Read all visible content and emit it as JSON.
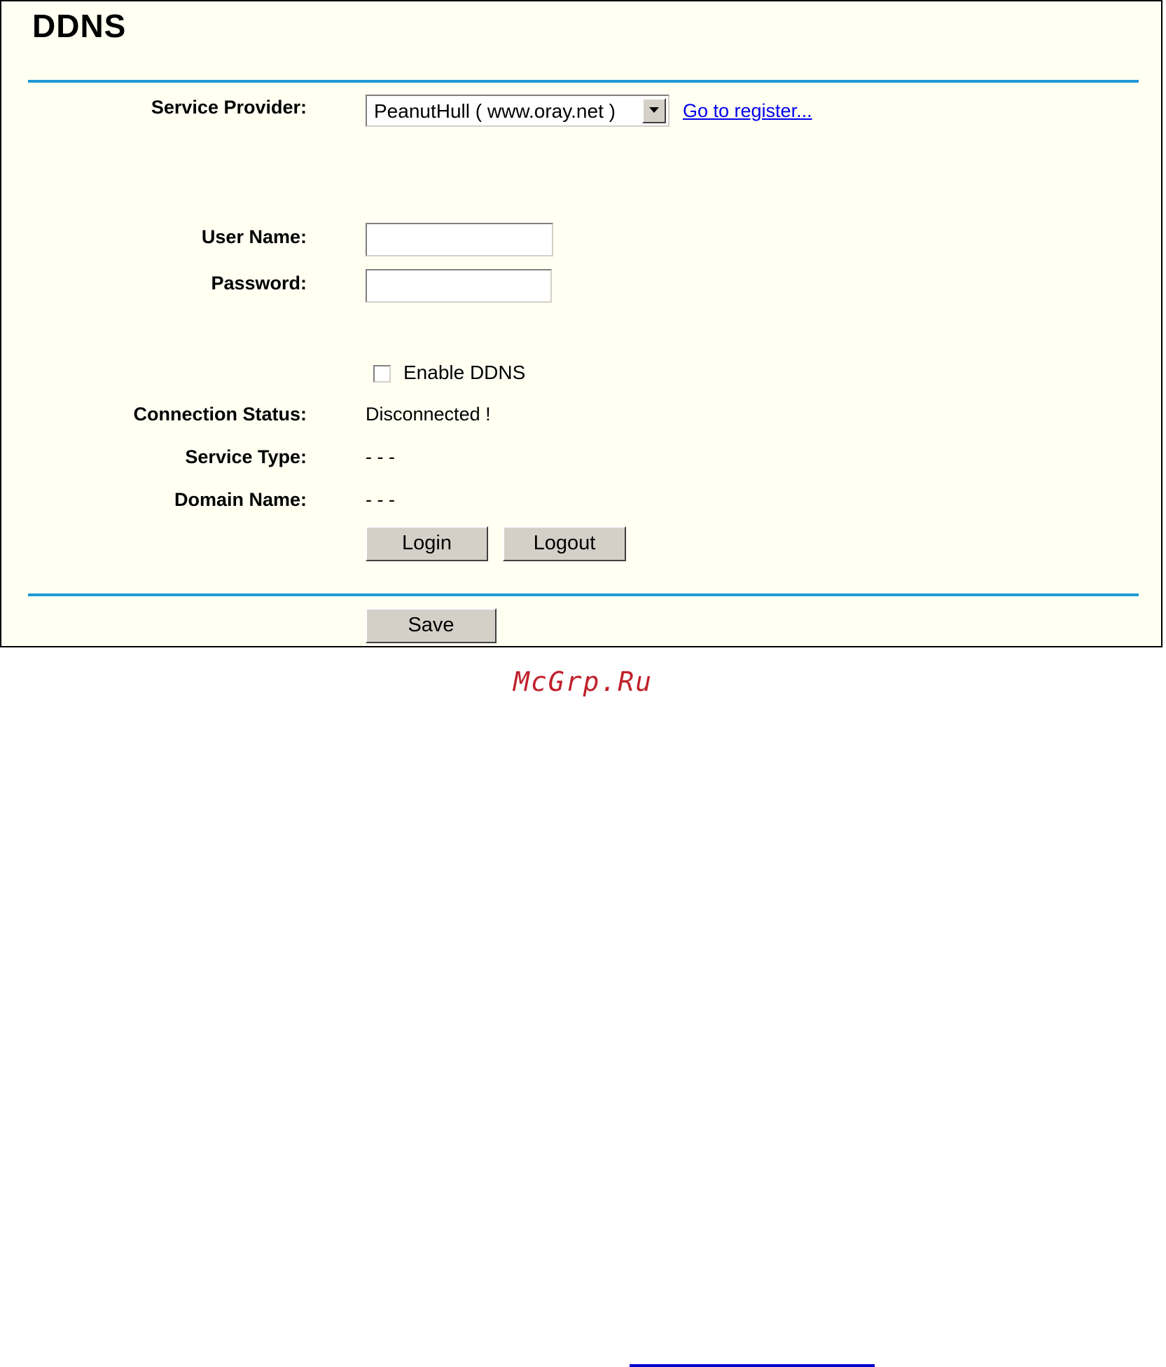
{
  "page": {
    "title": "DDNS"
  },
  "form": {
    "service_provider": {
      "label": "Service Provider:",
      "selected": "PeanutHull ( www.oray.net )",
      "register_link": "Go to register..."
    },
    "user_name": {
      "label": "User Name:",
      "value": ""
    },
    "password": {
      "label": "Password:",
      "value": ""
    },
    "enable_ddns": {
      "label": "Enable DDNS",
      "checked": false
    },
    "connection_status": {
      "label": "Connection Status:",
      "value": "Disconnected !"
    },
    "service_type": {
      "label": "Service Type:",
      "value": "- - -"
    },
    "domain_name": {
      "label": "Domain Name:",
      "value": "- - -"
    },
    "buttons": {
      "login": "Login",
      "logout": "Logout",
      "save": "Save"
    }
  },
  "watermark": {
    "text": "McGrp.Ru"
  },
  "colors": {
    "panel_background": "#fffff2",
    "rule": "#1e9ad6",
    "link": "#0000ee",
    "watermark": "#c0202a",
    "button_face": "#d4d0c8"
  }
}
